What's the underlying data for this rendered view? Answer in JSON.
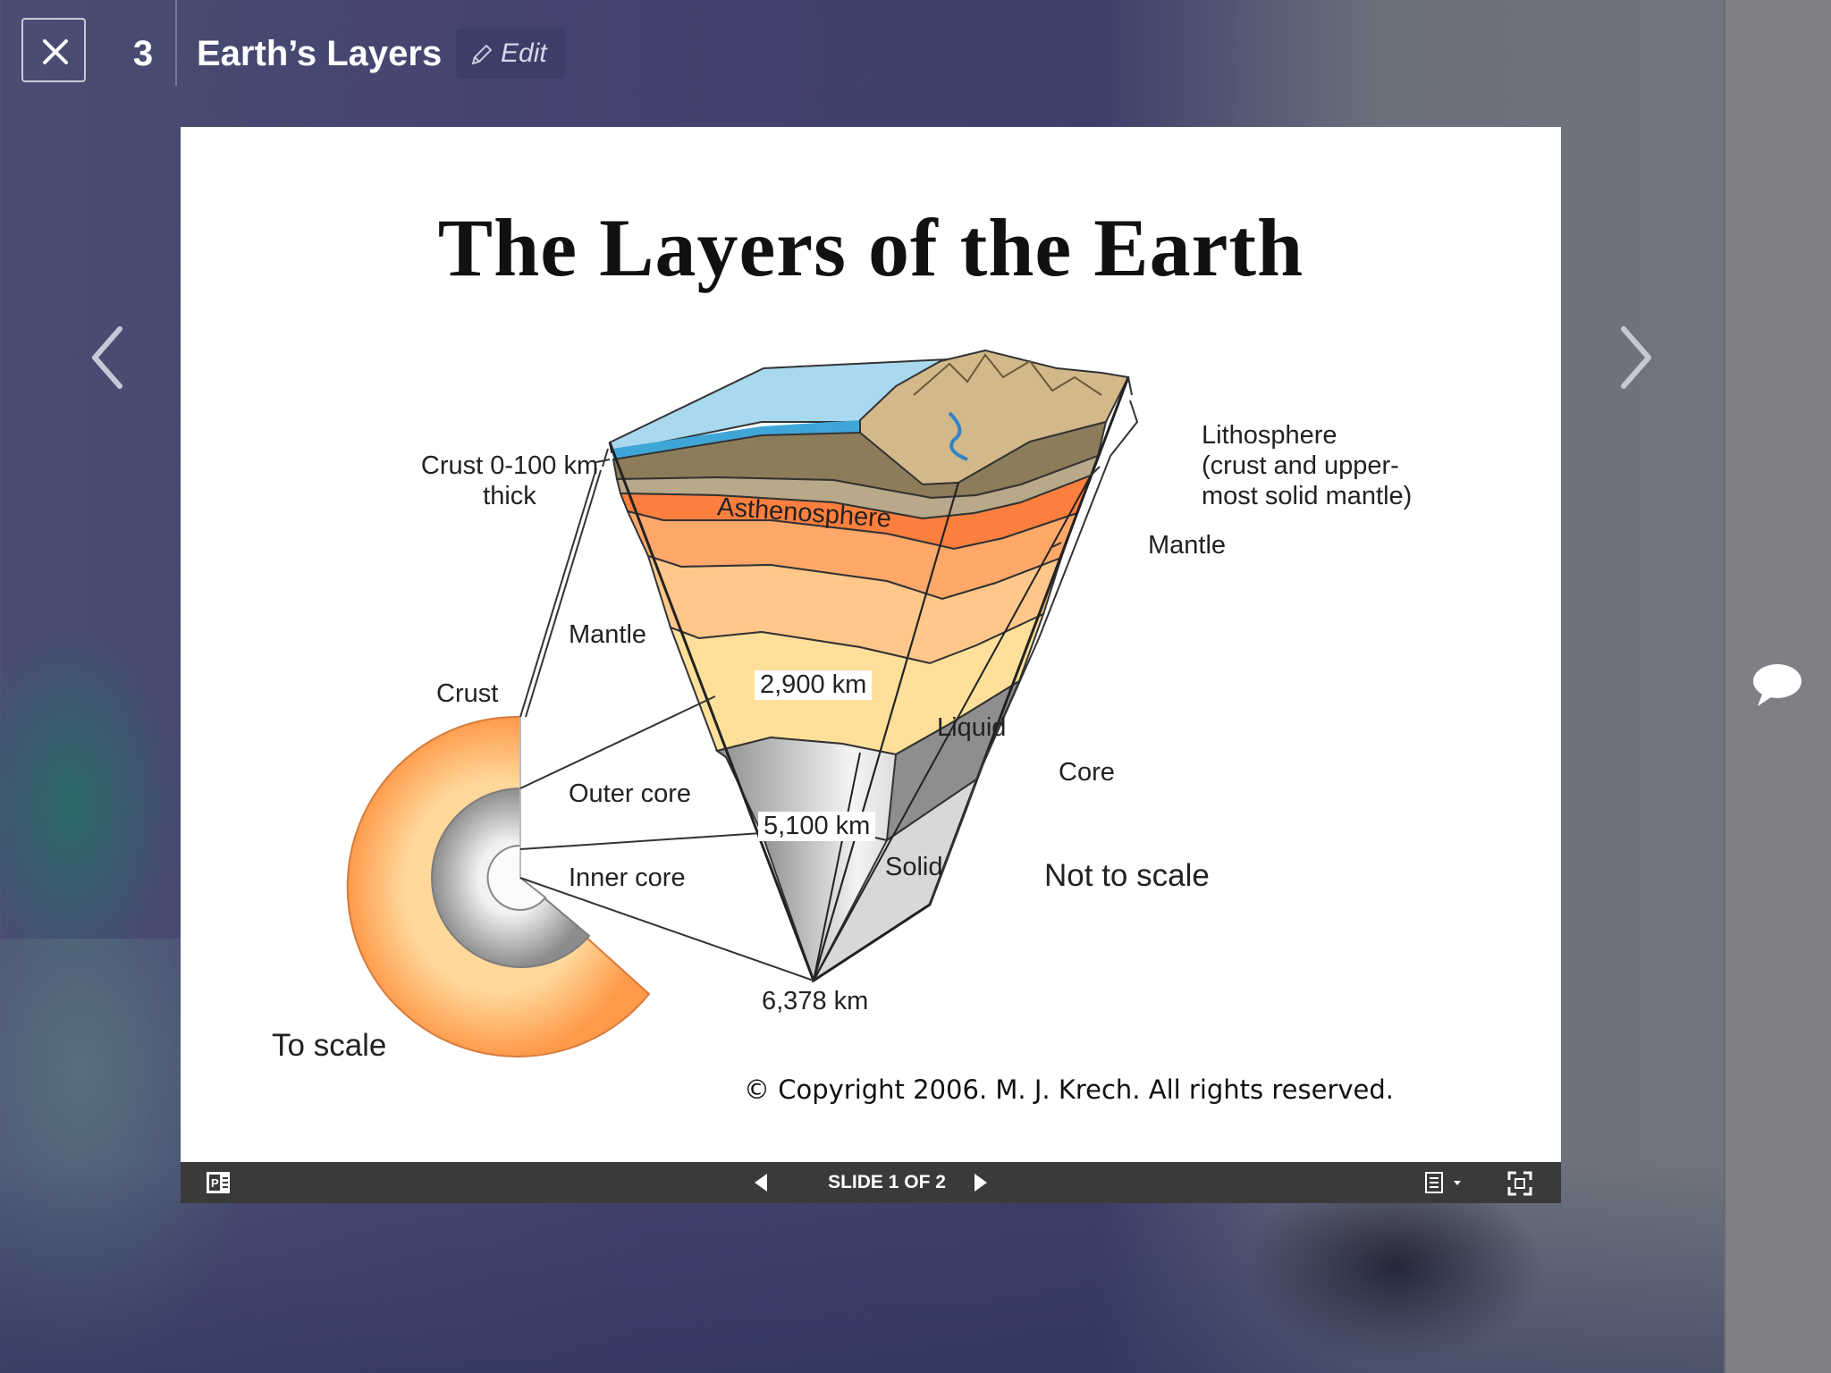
{
  "header": {
    "slide_number": "3",
    "deck_title": "Earth’s Layers",
    "edit_label": "Edit"
  },
  "slide": {
    "title": "The Layers of the Earth",
    "labels": {
      "crust_thickness": "Crust 0-100 km\nthick",
      "lithosphere": "Lithosphere\n(crust and upper-\nmost solid mantle)",
      "mantle_right": "Mantle",
      "asthenosphere": "Asthenosphere",
      "mantle_left": "Mantle",
      "crust": "Crust",
      "depth_2900": "2,900 km",
      "liquid": "Liquid",
      "core": "Core",
      "outer_core": "Outer core",
      "depth_5100": "5,100 km",
      "inner_core": "Inner core",
      "solid": "Solid",
      "not_to_scale": "Not to scale",
      "depth_6378": "6,378 km",
      "to_scale": "To scale"
    },
    "copyright": "© Copyright 2006.  M. J. Krech. All rights reserved."
  },
  "toolbar": {
    "counter": "SLIDE 1 OF 2"
  },
  "icons": {
    "close": "close-icon",
    "edit": "pencil-icon",
    "prev": "chevron-left-icon",
    "next": "chevron-right-icon",
    "comment": "speech-bubble-icon"
  }
}
